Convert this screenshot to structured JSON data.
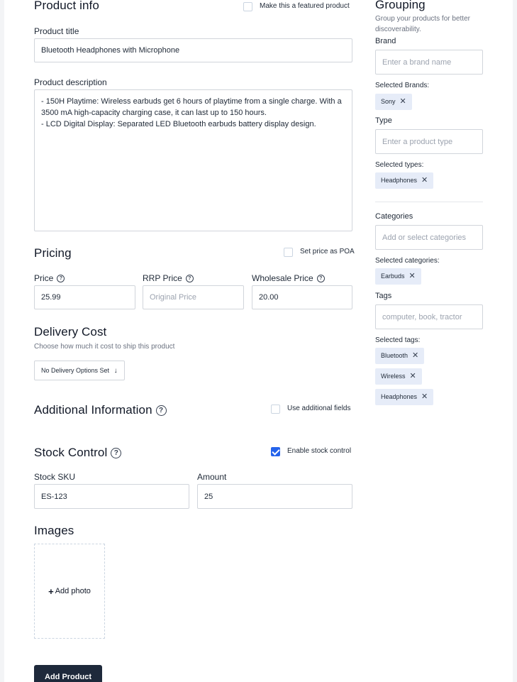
{
  "product_info": {
    "heading": "Product info",
    "featured_label": "Make this a featured product",
    "featured_checked": false,
    "title_label": "Product title",
    "title_value": "Bluetooth Headphones with Microphone",
    "description_label": "Product description",
    "description_value": "- 150H Playtime: Wireless earbuds get 6 hours of playtime from a single charge. With a 3500 mA high-capacity charging case, it can last up to 150 hours.\n- LCD Digital Display: Separated LED Bluetooth earbuds battery display design."
  },
  "pricing": {
    "heading": "Pricing",
    "poa_label": "Set price as POA",
    "poa_checked": false,
    "price_label": "Price",
    "price_value": "25.99",
    "rrp_label": "RRP Price",
    "rrp_placeholder": "Original Price",
    "wholesale_label": "Wholesale Price",
    "wholesale_value": "20.00"
  },
  "delivery": {
    "heading": "Delivery Cost",
    "subtitle": "Choose how much it cost to ship this product",
    "dropdown_label": "No Delivery Options Set",
    "dropdown_icon": "arrow-down-icon"
  },
  "additional": {
    "heading": "Additional Information",
    "use_fields_label": "Use additional fields",
    "use_fields_checked": false
  },
  "stock": {
    "heading": "Stock Control",
    "enable_label": "Enable stock control",
    "enable_checked": true,
    "sku_label": "Stock SKU",
    "sku_value": "ES-123",
    "amount_label": "Amount",
    "amount_value": "25"
  },
  "images": {
    "heading": "Images",
    "add_photo_label": "Add photo",
    "add_photo_icon": "+"
  },
  "submit_label": "Add Product",
  "grouping": {
    "heading": "Grouping",
    "subtitle": "Group your products for better discoverability.",
    "brand_label": "Brand",
    "brand_placeholder": "Enter a brand name",
    "selected_brands_label": "Selected Brands:",
    "brands": [
      "Sony"
    ],
    "type_label": "Type",
    "type_placeholder": "Enter a product type",
    "selected_types_label": "Selected types:",
    "types": [
      "Headphones"
    ],
    "categories_label": "Categories",
    "categories_placeholder": "Add or select categories",
    "selected_categories_label": "Selected categories:",
    "categories": [
      "Earbuds"
    ],
    "tags_label": "Tags",
    "tags_placeholder": "computer, book, tractor",
    "selected_tags_label": "Selected tags:",
    "tags": [
      "Bluetooth",
      "Wireless",
      "Headphones"
    ],
    "remove_glyph": "✕"
  },
  "colors": {
    "primary_button": "#1e293b",
    "checkbox_checked": "#2563eb",
    "chip_bg": "#e6ecf8"
  }
}
